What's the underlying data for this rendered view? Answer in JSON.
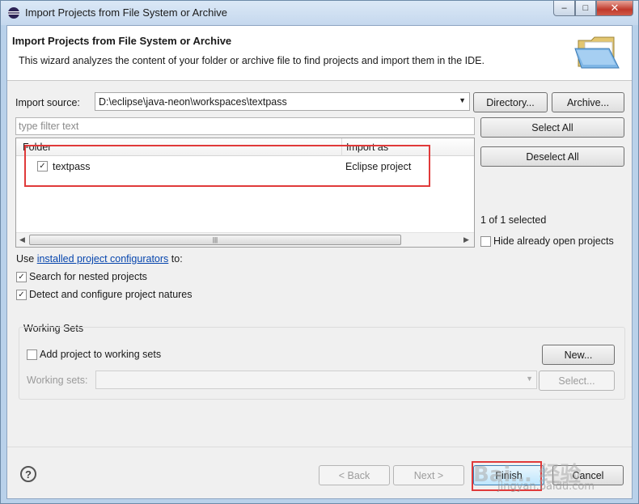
{
  "window": {
    "title": "Import Projects from File System or Archive",
    "controls": {
      "minimize": "–",
      "maximize": "□",
      "close": "✕"
    }
  },
  "header": {
    "title": "Import Projects from File System or Archive",
    "description": "This wizard analyzes the content of your folder or archive file to find projects and import them in the IDE.",
    "icon": "open-folder-icon"
  },
  "import_source": {
    "label": "Import source:",
    "value": "D:\\eclipse\\java-neon\\workspaces\\textpass",
    "directory_button": "Directory...",
    "archive_button": "Archive..."
  },
  "filter": {
    "placeholder": "type filter text"
  },
  "table": {
    "columns": [
      "Folder",
      "Import as"
    ],
    "rows": [
      {
        "checked": true,
        "folder": "textpass",
        "import_as": "Eclipse project"
      }
    ]
  },
  "selection": {
    "select_all": "Select All",
    "deselect_all": "Deselect All",
    "status": "1 of 1 selected",
    "hide_open_label": "Hide already open projects",
    "hide_open_checked": false
  },
  "configurators": {
    "prefix": "Use ",
    "link": "installed project configurators",
    "suffix": " to:",
    "options": [
      {
        "label": "Search for nested projects",
        "checked": true
      },
      {
        "label": "Detect and configure project natures",
        "checked": true
      }
    ]
  },
  "working_sets": {
    "group_title": "Working Sets",
    "add_label": "Add project to working sets",
    "add_checked": false,
    "new_button": "New...",
    "sets_label": "Working sets:",
    "sets_value": "",
    "select_button": "Select..."
  },
  "footer": {
    "help": "?",
    "back": "< Back",
    "next": "Next >",
    "finish": "Finish",
    "cancel": "Cancel"
  },
  "watermark": {
    "main": "Bai… 经验",
    "sub": "jingyan.baidu.com"
  },
  "colors": {
    "annotation": "#e03a3a",
    "link": "#0645ad",
    "titlebar": "#c5d8ee"
  }
}
